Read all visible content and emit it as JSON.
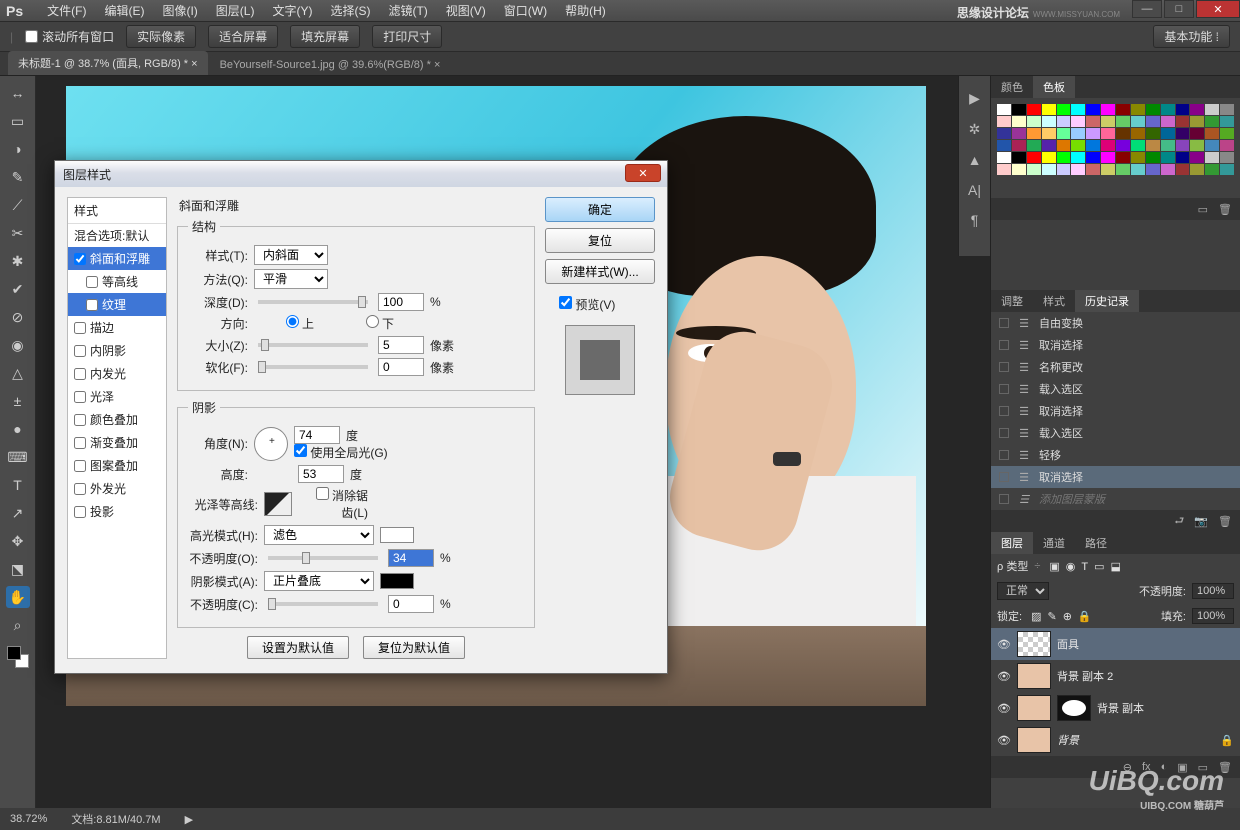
{
  "brand": {
    "name": "思缘设计论坛",
    "url": "WWW.MISSYUAN.COM"
  },
  "window_controls": {
    "min": "—",
    "max": "□",
    "close": "✕"
  },
  "menubar": {
    "logo": "Ps",
    "items": [
      "文件(F)",
      "编辑(E)",
      "图像(I)",
      "图层(L)",
      "文字(Y)",
      "选择(S)",
      "滤镜(T)",
      "视图(V)",
      "窗口(W)",
      "帮助(H)"
    ]
  },
  "optbar": {
    "hand": "✋",
    "scroll_all": "滚动所有窗口",
    "btns": [
      "实际像素",
      "适合屏幕",
      "填充屏幕",
      "打印尺寸"
    ],
    "workspace": "基本功能"
  },
  "doctabs": [
    {
      "label": "未标题-1 @ 38.7% (面具, RGB/8) *",
      "close": "×",
      "active": true
    },
    {
      "label": "BeYourself-Source1.jpg @ 39.6%(RGB/8) *",
      "close": "×",
      "active": false
    }
  ],
  "tools": [
    "↔",
    "▭",
    "◑",
    "✎",
    "⟋",
    "✂",
    "✱",
    "✔",
    "⊘",
    "◉",
    "△",
    "±",
    "●",
    "⌨",
    "T",
    "↗",
    "✥",
    "⬔",
    "✋",
    "⌕"
  ],
  "dock_strip": [
    "▶",
    "✲",
    "▲",
    "A|",
    "¶"
  ],
  "swatch_panel": {
    "tabs": [
      "颜色",
      "色板"
    ],
    "active": 1,
    "foot_icons": [
      "▭",
      "🗑"
    ]
  },
  "history_panel": {
    "tabs": [
      "调整",
      "样式",
      "历史记录"
    ],
    "active": 2,
    "items": [
      {
        "label": "自由变换"
      },
      {
        "label": "取消选择"
      },
      {
        "label": "名称更改"
      },
      {
        "label": "载入选区"
      },
      {
        "label": "取消选择"
      },
      {
        "label": "载入选区"
      },
      {
        "label": "轻移"
      },
      {
        "label": "取消选择",
        "sel": true
      },
      {
        "label": "添加图层蒙版",
        "dim": true
      }
    ],
    "foot_icons": [
      "⮐",
      "📷",
      "🗑"
    ]
  },
  "layers_panel": {
    "tabs": [
      "图层",
      "通道",
      "路径"
    ],
    "active": 0,
    "type": "ρ 类型",
    "type_icons": [
      "▣",
      "◉",
      "T",
      "▭",
      "⬓"
    ],
    "blend": "正常",
    "opacity_label": "不透明度:",
    "opacity": "100%",
    "lock_label": "锁定:",
    "lock_icons": [
      "▨",
      "✎",
      "⊕",
      "🔒"
    ],
    "fill_label": "填充:",
    "fill": "100%",
    "layers": [
      {
        "name": "面具",
        "sel": true,
        "thumb": "trans"
      },
      {
        "name": "背景 副本 2",
        "thumb": "bglock"
      },
      {
        "name": "背景 副本",
        "thumb": "bglock",
        "mask": true
      },
      {
        "name": "背景",
        "thumb": "bglock",
        "locked": true,
        "italic": true
      }
    ],
    "foot_icons": [
      "⊖",
      "fx",
      "◐",
      "▣",
      "▭",
      "🗑"
    ]
  },
  "status": {
    "zoom": "38.72%",
    "doc": "文档:8.81M/40.7M"
  },
  "watermark": {
    "big": "UiBQ.com",
    "small": "UIBQ.COM 糖葫芦"
  },
  "dialog": {
    "title": "图层样式",
    "ok": "确定",
    "reset": "复位",
    "new_style": "新建样式(W)...",
    "preview": "预览(V)",
    "list_header": "样式",
    "blend_defaults": "混合选项:默认",
    "styles": [
      {
        "label": "斜面和浮雕",
        "checked": true,
        "sel": true
      },
      {
        "label": "等高线",
        "sub": true
      },
      {
        "label": "纹理",
        "sub": true,
        "subsel": true
      },
      {
        "label": "描边"
      },
      {
        "label": "内阴影"
      },
      {
        "label": "内发光"
      },
      {
        "label": "光泽"
      },
      {
        "label": "颜色叠加"
      },
      {
        "label": "渐变叠加"
      },
      {
        "label": "图案叠加"
      },
      {
        "label": "外发光"
      },
      {
        "label": "投影"
      }
    ],
    "bevel": {
      "section": "斜面和浮雕",
      "group1": "结构",
      "style_label": "样式(T):",
      "style_val": "内斜面",
      "tech_label": "方法(Q):",
      "tech_val": "平滑",
      "depth_label": "深度(D):",
      "depth_val": "100",
      "pct": "%",
      "dir_label": "方向:",
      "up": "上",
      "down": "下",
      "size_label": "大小(Z):",
      "size_val": "5",
      "px": "像素",
      "soft_label": "软化(F):",
      "soft_val": "0",
      "group2": "阴影",
      "angle_label": "角度(N):",
      "angle_val": "74",
      "deg": "度",
      "global": "使用全局光(G)",
      "alt_label": "高度:",
      "alt_val": "53",
      "gloss_label": "光泽等高线:",
      "aa": "消除锯齿(L)",
      "hi_mode_label": "高光模式(H):",
      "hi_mode": "滤色",
      "hi_color": "#ffffff",
      "hi_opac_label": "不透明度(O):",
      "hi_opac": "34",
      "sh_mode_label": "阴影模式(A):",
      "sh_mode": "正片叠底",
      "sh_color": "#000000",
      "sh_opac_label": "不透明度(C):",
      "sh_opac": "0",
      "set_default": "设置为默认值",
      "reset_default": "复位为默认值"
    }
  }
}
